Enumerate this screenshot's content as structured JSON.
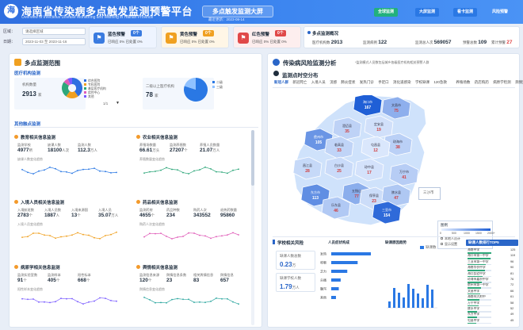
{
  "header": {
    "logo_char": "海",
    "title": "海南省传染病多点触发监测预警平台",
    "subtitle_en": "Overview of Infectious Disease Monitoring and Warning in Hainan Province",
    "screen_name": "多点触发监测大屏",
    "update_label": "最近更新：2023-08-14",
    "buttons": [
      "全球监测",
      "大屏监测",
      "看卡监测",
      "风险预警"
    ]
  },
  "filters": {
    "region_label": "区域：",
    "region_value": "请选择区域",
    "date_label": "日期：",
    "date_value": "2023-11-03 至 2023-11-16"
  },
  "warnings": [
    {
      "name": "蓝色预警",
      "count": "0个",
      "resp_label": "已响应",
      "resp": "0%",
      "done_label": "已处置",
      "done": "0%",
      "color": "#3a7be0",
      "bg": "#eef4ff",
      "icon": "⚑"
    },
    {
      "name": "黄色预警",
      "count": "0个",
      "resp_label": "已响应",
      "resp": "0%",
      "done_label": "已处置",
      "done": "0%",
      "color": "#f0a020",
      "bg": "#fff6e6",
      "icon": "⚑"
    },
    {
      "name": "红色预警",
      "count": "0个",
      "resp_label": "已响应",
      "resp": "0%",
      "done_label": "已处置",
      "done": "0%",
      "color": "#e04848",
      "bg": "#fdeeee",
      "icon": "⚑"
    }
  ],
  "multi": {
    "title": "多点监测概况",
    "stats": [
      {
        "label": "医疗机构数",
        "value": "2913"
      },
      {
        "label": "监测病例",
        "value": "122"
      },
      {
        "label": "监测总人次",
        "value": "569057"
      },
      {
        "label": "预警总数",
        "value": "109"
      },
      {
        "label": "累计预警",
        "value": "27"
      }
    ]
  },
  "left": {
    "title": "多点监测范围",
    "med_section": "医疗机构监测",
    "med_label": "机构数量",
    "med_value": "2913",
    "med_unit": "家",
    "pie_legend": [
      "综合医院",
      "专科医院",
      "基层医疗机构",
      "疾控中心",
      "其他"
    ],
    "pie_colors": [
      "#2f6fe0",
      "#f0a020",
      "#2ea77a",
      "#e05cb8",
      "#7a5cff"
    ],
    "pie_values": [
      40,
      20,
      25,
      8,
      7
    ],
    "two_label": "二级以上医疗机构",
    "two_value": "78",
    "two_unit": "家",
    "two_legend": [
      "二级",
      "三级"
    ],
    "two_values": [
      80,
      20
    ],
    "page_label": "1/1",
    "other_section": "其他触点监测",
    "subs": [
      {
        "title": "教育相关信息监测",
        "labels": [
          "监测学校",
          "缺课人数",
          "监测人数"
        ],
        "values": [
          "4977",
          "18100",
          "112.3"
        ],
        "units": [
          "所",
          "人次",
          "万人"
        ],
        "trend": "缺课人数变化趋势"
      },
      {
        "title": "农业相关信息监测",
        "labels": [
          "养殖场数量",
          "监测养殖数",
          "养殖人员数量"
        ],
        "values": [
          "66.61",
          "27207",
          "21.07"
        ],
        "units": [
          "万头",
          "个",
          "万人"
        ],
        "trend": "养殖数量变化趋势"
      },
      {
        "title": "入境人员相关信息监测",
        "labels": [
          "入境航班数",
          "入境人员数",
          "入境来源国",
          "入境人员"
        ],
        "values": [
          "2783",
          "1887",
          "13",
          "35.07"
        ],
        "units": [
          "个",
          "人",
          "个",
          "万人"
        ],
        "trend": "入境人员变化趋势"
      },
      {
        "title": "药品相关信息监测",
        "labels": [
          "监测药房",
          "药品种数",
          "购药人次",
          "退热药数量"
        ],
        "values": [
          "4655",
          "234",
          "343552",
          "95860"
        ],
        "units": [
          "个",
          "",
          "",
          ""
        ],
        "trend": "购药人次变化趋势"
      },
      {
        "title": "病原学相关信息监测",
        "labels": [
          "监测实验室数",
          "监测样本",
          "阳性标本"
        ],
        "values": [
          "91",
          "405",
          "668"
        ],
        "units": [
          "个",
          "个",
          "个"
        ],
        "trend": "阳性样本变化趋势"
      },
      {
        "title": "舆情相关信息监测",
        "labels": [
          "监测信息来源",
          "舆情信息条数",
          "相关舆情信息",
          "舆情信息"
        ],
        "values": [
          "120",
          "23",
          "83",
          "657"
        ],
        "units": [
          "个",
          "",
          "",
          ""
        ],
        "trend": "舆情信息变化趋势"
      }
    ]
  },
  "right": {
    "title": "传染病风险监测分析",
    "note": "*监测模式人员数包括城乡各级医疗机构相关预警人群",
    "map_section": "监测点时空分布",
    "tabs": [
      "新冠人群",
      "新冠死亡",
      "入境人员",
      "流感",
      "肺炎症状",
      "发热门诊",
      "手足口",
      "消化道感染",
      "学校缺课",
      "120急救",
      "养殖场数",
      "药店购药",
      "病原学检测",
      "舆情监测"
    ],
    "regions": [
      {
        "name": "海口市",
        "value": "167"
      },
      {
        "name": "文昌市",
        "value": "75"
      },
      {
        "name": "定安县",
        "value": "19"
      },
      {
        "name": "澄迈县",
        "value": "35"
      },
      {
        "name": "儋州市",
        "value": "105"
      },
      {
        "name": "临高县",
        "value": "33"
      },
      {
        "name": "琼海市",
        "value": "38"
      },
      {
        "name": "屯昌县",
        "value": "12"
      },
      {
        "name": "白沙县",
        "value": "25"
      },
      {
        "name": "昌江县",
        "value": "28"
      },
      {
        "name": "琼中县",
        "value": "17"
      },
      {
        "name": "万宁市",
        "value": "41"
      },
      {
        "name": "东方市",
        "value": "113"
      },
      {
        "name": "五指山",
        "value": "77"
      },
      {
        "name": "乐东县",
        "value": "46"
      },
      {
        "name": "保亭县",
        "value": "23"
      },
      {
        "name": "陵水县",
        "value": "47"
      },
      {
        "name": "三亚市",
        "value": "154"
      }
    ],
    "islands": "三沙市",
    "legend_title": "图例",
    "legend_ticks": [
      "0",
      "500",
      "1000",
      "1500",
      "2000+"
    ],
    "legend_checks": [
      "本地人员计",
      "显示设置"
    ],
    "school_section": "学校相关风险",
    "school_sub": "人员症状构成",
    "school_box1_label": "缺课人数总数",
    "school_box1_value": "0.23",
    "school_box1_unit": "万",
    "school_box2_label": "缺课学校人数",
    "school_box2_value": "1.79",
    "school_box2_unit": "万人",
    "symptom_labels": [
      "发热",
      "咳嗽",
      "乏力",
      "头痛",
      "腹泻",
      "其他"
    ],
    "symptom_values": [
      42,
      28,
      17,
      10,
      8,
      5
    ],
    "trend_title": "缺课原因趋势",
    "trend_legend": "缺课数",
    "rank_title": "缺课人数排行TOP5",
    "rank": [
      {
        "name": "海南中学",
        "value": "125"
      },
      {
        "name": "海口市第一中学",
        "value": "119"
      },
      {
        "name": "三亚市第一中学",
        "value": "96"
      },
      {
        "name": "海南华侨中学",
        "value": "90"
      },
      {
        "name": "海口实验中学",
        "value": "81"
      },
      {
        "name": "琼海市嘉积中学",
        "value": "76"
      },
      {
        "name": "儋州市第一中学",
        "value": "72"
      },
      {
        "name": "文昌中学",
        "value": "66"
      },
      {
        "name": "海南师大附中",
        "value": "61"
      },
      {
        "name": "万宁中学",
        "value": "58"
      },
      {
        "name": "陵水中学",
        "value": "52"
      },
      {
        "name": "东方中学",
        "value": "49"
      },
      {
        "name": "屯昌中学",
        "value": "45"
      }
    ]
  }
}
